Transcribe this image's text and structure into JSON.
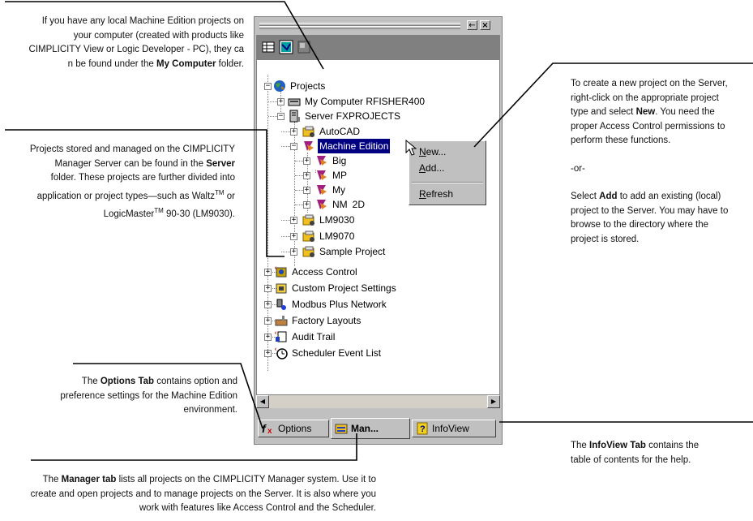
{
  "callouts": {
    "local_projects": {
      "l1": "If you have any local Machine Edition projects on",
      "l2": "your computer (created with products like",
      "l3": "CIMPLICITY View or Logic Developer - PC), they ca",
      "l4a": "n be found under the ",
      "l4b": "My Computer",
      "l4c": " folder."
    },
    "server_projects": {
      "l1": "Projects stored and managed on the CIMPLICITY",
      "l2a": "Manager Server can be found in the ",
      "l2b": "Server",
      "l3": "folder. These projects are further divided into",
      "l4a": "application or project types—such as Waltz",
      "tm1": "TM",
      "l4b": " or",
      "l5a": "LogicMaster",
      "tm2": "TM",
      "l5b": " 90-30 (LM9030)."
    },
    "new_project": {
      "l1": "To create a new project on the Server,",
      "l2": "right-click on the appropriate project",
      "l3a": "type and select ",
      "l3b": "New",
      "l3c": ". You need the",
      "l4": "proper Access Control permissions to",
      "l5": "perform these functions.",
      "or": "-or-",
      "a1a": "Select ",
      "a1b": "Add",
      "a1c": " to add an existing (local)",
      "a2": "project to the Server. You may have to",
      "a3": "browse to the directory where the",
      "a4": "project is stored."
    },
    "options_tab": {
      "l1a": "The ",
      "l1b": "Options Tab",
      "l1c": " contains option and",
      "l2": "preference settings for the Machine Edition",
      "l3": "environment."
    },
    "infoview_tab": {
      "l1a": "The ",
      "l1b": "InfoView Tab",
      "l1c": " contains the",
      "l2": "table of contents for the help."
    },
    "manager_tab": {
      "l1a": "The ",
      "l1b": "Manager tab",
      "l1c": " lists all projects on the CIMPLICITY Manager system. Use it to",
      "l2": "create and open projects and to manage projects on the Server. It is also where you",
      "l3": "work with features like Access Control and the Scheduler."
    }
  },
  "window": {
    "title_buttons": [
      "←",
      "×"
    ],
    "tree": {
      "projects": "Projects",
      "my_computer": "My Computer RFISHER400",
      "server": "Server FXPROJECTS",
      "autocad": "AutoCAD",
      "machine_edition": "Machine Edition",
      "big": "Big",
      "mp": "MP",
      "my": "My",
      "nm": "NM",
      "nm_suffix": "2D",
      "lm9030": "LM9030",
      "lm9070": "LM9070",
      "sample": "Sample Project",
      "access_control": "Access Control",
      "custom_settings": "Custom Project Settings",
      "modbus": "Modbus Plus Network",
      "factory": "Factory Layouts",
      "audit": "Audit Trail",
      "scheduler": "Scheduler Event List"
    },
    "context_menu": {
      "new_u": "N",
      "new_rest": "ew...",
      "add_u": "A",
      "add_rest": "dd...",
      "refresh_u": "R",
      "refresh_rest": "efresh"
    },
    "tabs": {
      "options": "Options",
      "manager": "Man...",
      "infoview": "InfoView"
    }
  },
  "colors": {
    "selection": "#000080",
    "window_bg": "#c0c0c0",
    "toolbar_bg": "#808080"
  }
}
